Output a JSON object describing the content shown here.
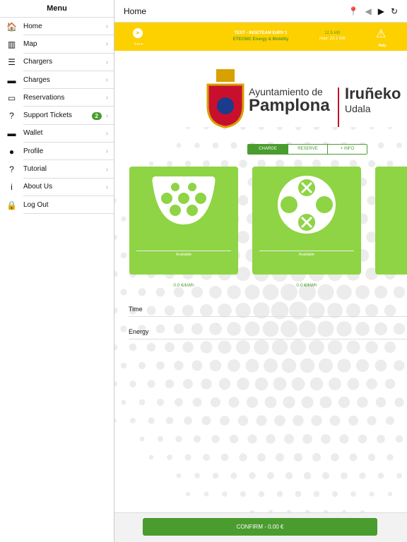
{
  "sidebar": {
    "title": "Menu",
    "items": [
      {
        "label": "Home",
        "icon": "home-icon",
        "glyph": "🏠"
      },
      {
        "label": "Map",
        "icon": "map-icon",
        "glyph": "▥"
      },
      {
        "label": "Chargers",
        "icon": "list-icon",
        "glyph": "☰"
      },
      {
        "label": "Charges",
        "icon": "battery-icon",
        "glyph": "▬"
      },
      {
        "label": "Reservations",
        "icon": "calendar-icon",
        "glyph": "▭"
      },
      {
        "label": "Support Tickets",
        "icon": "help-circle-icon",
        "glyph": "?",
        "badge": "2"
      },
      {
        "label": "Wallet",
        "icon": "card-icon",
        "glyph": "▬"
      },
      {
        "label": "Profile",
        "icon": "person-icon",
        "glyph": "●"
      },
      {
        "label": "Tutorial",
        "icon": "question-icon",
        "glyph": "?"
      },
      {
        "label": "About Us",
        "icon": "info-icon",
        "glyph": "i"
      },
      {
        "label": "Log Out",
        "icon": "lock-icon",
        "glyph": "🔒"
      }
    ]
  },
  "header": {
    "title": "Home"
  },
  "station": {
    "distance": "0 m ▾",
    "name": "TEST - INGETEAM EdRV 1",
    "operator": "ETECNIC Energy & Mobility",
    "power": "12.5 kW",
    "max_power": "max: 22.1 kW",
    "help": "Help"
  },
  "logo": {
    "line1": "Ayuntamiento de",
    "line2": "Pamplona",
    "line3": "Iruñeko",
    "line4": "Udala"
  },
  "tabs": [
    "CHARGE",
    "RESERVE",
    "+ INFO"
  ],
  "connectors": [
    {
      "status": "Available",
      "price": "0.0 €/kWh"
    },
    {
      "status": "Available",
      "price": "0.0 €/kWh"
    }
  ],
  "fields": {
    "time": "Time",
    "energy": "Energy"
  },
  "confirm": "CONFIRM - 0.00 €",
  "colors": {
    "accent": "#4a9c2f",
    "yellow": "#fdd000",
    "card": "#8ed444"
  }
}
